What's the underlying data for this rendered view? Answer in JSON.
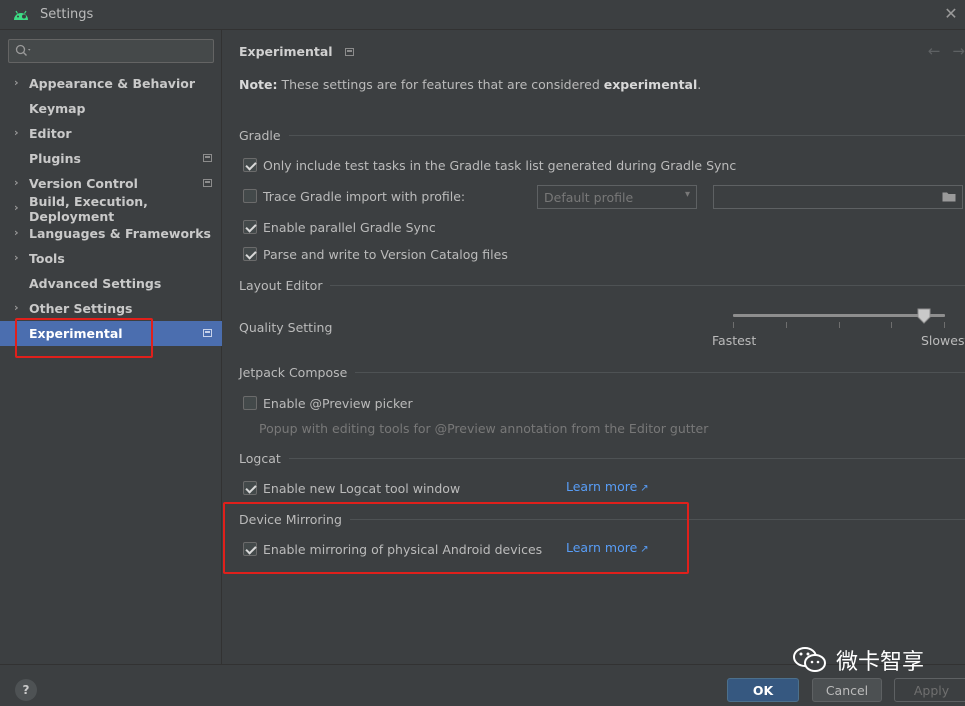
{
  "window": {
    "title": "Settings",
    "close_glyph": "✕",
    "app_icon": "android-icon"
  },
  "sidebar": {
    "search_placeholder": "",
    "items": [
      {
        "label": "Appearance & Behavior",
        "expandable": true,
        "project_icon": false
      },
      {
        "label": "Keymap",
        "expandable": false,
        "project_icon": false
      },
      {
        "label": "Editor",
        "expandable": true,
        "project_icon": false
      },
      {
        "label": "Plugins",
        "expandable": false,
        "project_icon": true
      },
      {
        "label": "Version Control",
        "expandable": true,
        "project_icon": true
      },
      {
        "label": "Build, Execution, Deployment",
        "expandable": true,
        "project_icon": false
      },
      {
        "label": "Languages & Frameworks",
        "expandable": true,
        "project_icon": false
      },
      {
        "label": "Tools",
        "expandable": true,
        "project_icon": false
      },
      {
        "label": "Advanced Settings",
        "expandable": false,
        "project_icon": false
      },
      {
        "label": "Other Settings",
        "expandable": true,
        "project_icon": false
      },
      {
        "label": "Experimental",
        "expandable": false,
        "project_icon": true,
        "selected": true
      }
    ]
  },
  "main": {
    "title": "Experimental",
    "back_glyph": "←",
    "forward_glyph": "→",
    "note_prefix": "Note:",
    "note_text": " These settings are for features that are considered ",
    "note_emphasis": "experimental",
    "note_suffix": ".",
    "gradle": {
      "title": "Gradle",
      "only_test_tasks": {
        "label": "Only include test tasks in the Gradle task list generated during Gradle Sync",
        "checked": true
      },
      "trace_import": {
        "label": "Trace Gradle import with profile:",
        "checked": false
      },
      "profile_dropdown": {
        "value": "Default profile",
        "arrow": "▾"
      },
      "profile_path": {
        "value": ""
      },
      "parallel_sync": {
        "label": "Enable parallel Gradle Sync",
        "checked": true
      },
      "version_catalog": {
        "label": "Parse and write to Version Catalog files",
        "checked": true
      }
    },
    "layout_editor": {
      "title": "Layout Editor",
      "quality_label": "Quality Setting",
      "slider_min_label": "Fastest",
      "slider_max_label": "Slowest",
      "slider_fraction": 0.9
    },
    "jetpack_compose": {
      "title": "Jetpack Compose",
      "preview_picker": {
        "label": "Enable @Preview picker",
        "checked": false
      },
      "hint": "Popup with editing tools for @Preview annotation from the Editor gutter"
    },
    "logcat": {
      "title": "Logcat",
      "new_window": {
        "label": "Enable new Logcat tool window",
        "checked": true
      },
      "learn_more": "Learn more",
      "learn_more_arrow": "↗"
    },
    "device_mirroring": {
      "title": "Device Mirroring",
      "mirroring": {
        "label": "Enable mirroring of physical Android devices",
        "checked": true
      },
      "learn_more": "Learn more",
      "learn_more_arrow": "↗"
    }
  },
  "footer": {
    "help": "?",
    "ok": "OK",
    "cancel": "Cancel",
    "apply": "Apply"
  },
  "watermark": {
    "text": "微卡智享",
    "icon": "wechat-icon"
  },
  "colors": {
    "accent": "#4b6eaf",
    "link": "#589df6",
    "highlight": "#e0201b",
    "ok_button": "#365880"
  }
}
